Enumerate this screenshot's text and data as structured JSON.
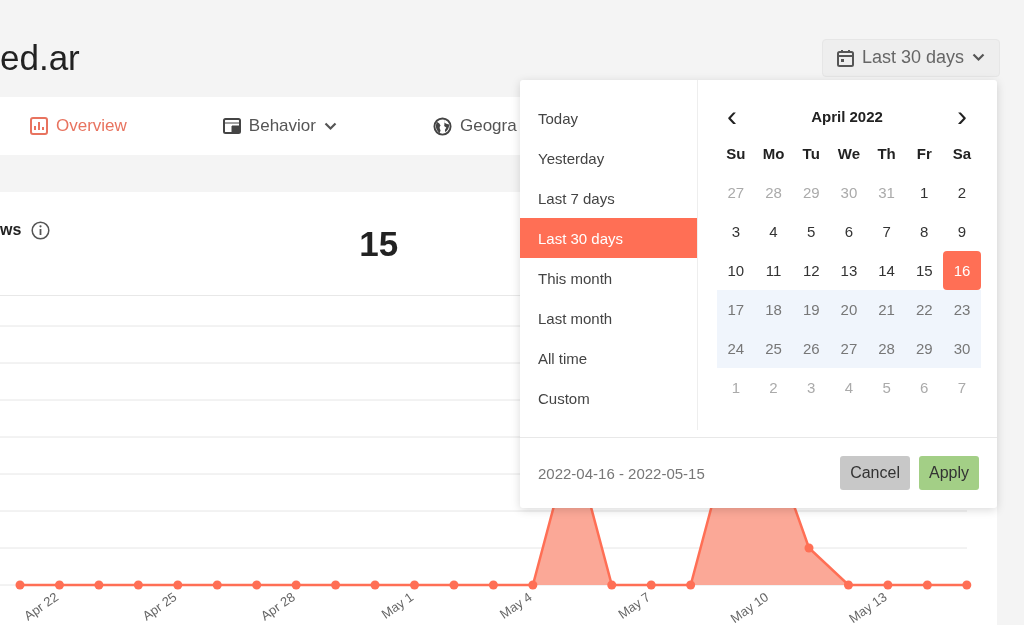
{
  "header": {
    "title": "ed.ar",
    "date_button": {
      "label": "Last 30 days"
    }
  },
  "nav": {
    "tabs": [
      {
        "label": "Overview",
        "kind": "chart",
        "dropdown": false,
        "selected": true
      },
      {
        "label": "Behavior",
        "kind": "layout",
        "dropdown": true,
        "selected": false
      },
      {
        "label": "Geogra",
        "kind": "globe",
        "dropdown": false,
        "selected": false
      }
    ]
  },
  "card": {
    "metric_label": "ws",
    "metric_value": "15",
    "chart": {
      "x_labels": [
        "Apr 22",
        "Apr 25",
        "Apr 28",
        "May 1",
        "May 4",
        "May 7",
        "May 10",
        "May 13"
      ]
    }
  },
  "date_picker": {
    "presets": [
      {
        "label": "Today",
        "selected": false
      },
      {
        "label": "Yesterday",
        "selected": false
      },
      {
        "label": "Last 7 days",
        "selected": false
      },
      {
        "label": "Last 30 days",
        "selected": true
      },
      {
        "label": "This month",
        "selected": false
      },
      {
        "label": "Last month",
        "selected": false
      },
      {
        "label": "All time",
        "selected": false
      },
      {
        "label": "Custom",
        "selected": false
      }
    ],
    "month": "April 2022",
    "prev": "‹",
    "next": "›",
    "weekdays": [
      "Su",
      "Mo",
      "Tu",
      "We",
      "Th",
      "Fr",
      "Sa"
    ],
    "weeks": [
      [
        {
          "day": "27",
          "outside": true,
          "selected": false,
          "in_range": false
        },
        {
          "day": "28",
          "outside": true,
          "selected": false,
          "in_range": false
        },
        {
          "day": "29",
          "outside": true,
          "selected": false,
          "in_range": false
        },
        {
          "day": "30",
          "outside": true,
          "selected": false,
          "in_range": false
        },
        {
          "day": "31",
          "outside": true,
          "selected": false,
          "in_range": false
        },
        {
          "day": "1",
          "outside": false,
          "selected": false,
          "in_range": false
        },
        {
          "day": "2",
          "outside": false,
          "selected": false,
          "in_range": false
        }
      ],
      [
        {
          "day": "3",
          "outside": false,
          "selected": false,
          "in_range": false
        },
        {
          "day": "4",
          "outside": false,
          "selected": false,
          "in_range": false
        },
        {
          "day": "5",
          "outside": false,
          "selected": false,
          "in_range": false
        },
        {
          "day": "6",
          "outside": false,
          "selected": false,
          "in_range": false
        },
        {
          "day": "7",
          "outside": false,
          "selected": false,
          "in_range": false
        },
        {
          "day": "8",
          "outside": false,
          "selected": false,
          "in_range": false
        },
        {
          "day": "9",
          "outside": false,
          "selected": false,
          "in_range": false
        }
      ],
      [
        {
          "day": "10",
          "outside": false,
          "selected": false,
          "in_range": false
        },
        {
          "day": "11",
          "outside": false,
          "selected": false,
          "in_range": false
        },
        {
          "day": "12",
          "outside": false,
          "selected": false,
          "in_range": false
        },
        {
          "day": "13",
          "outside": false,
          "selected": false,
          "in_range": false
        },
        {
          "day": "14",
          "outside": false,
          "selected": false,
          "in_range": false
        },
        {
          "day": "15",
          "outside": false,
          "selected": false,
          "in_range": false
        },
        {
          "day": "16",
          "outside": false,
          "selected": true,
          "in_range": false
        }
      ],
      [
        {
          "day": "17",
          "outside": false,
          "selected": false,
          "in_range": true
        },
        {
          "day": "18",
          "outside": false,
          "selected": false,
          "in_range": true
        },
        {
          "day": "19",
          "outside": false,
          "selected": false,
          "in_range": true
        },
        {
          "day": "20",
          "outside": false,
          "selected": false,
          "in_range": true
        },
        {
          "day": "21",
          "outside": false,
          "selected": false,
          "in_range": true
        },
        {
          "day": "22",
          "outside": false,
          "selected": false,
          "in_range": true
        },
        {
          "day": "23",
          "outside": false,
          "selected": false,
          "in_range": true
        }
      ],
      [
        {
          "day": "24",
          "outside": false,
          "selected": false,
          "in_range": true
        },
        {
          "day": "25",
          "outside": false,
          "selected": false,
          "in_range": true
        },
        {
          "day": "26",
          "outside": false,
          "selected": false,
          "in_range": true
        },
        {
          "day": "27",
          "outside": false,
          "selected": false,
          "in_range": true
        },
        {
          "day": "28",
          "outside": false,
          "selected": false,
          "in_range": true
        },
        {
          "day": "29",
          "outside": false,
          "selected": false,
          "in_range": true
        },
        {
          "day": "30",
          "outside": false,
          "selected": false,
          "in_range": true
        }
      ],
      [
        {
          "day": "1",
          "outside": true,
          "selected": false,
          "in_range": false
        },
        {
          "day": "2",
          "outside": true,
          "selected": false,
          "in_range": false
        },
        {
          "day": "3",
          "outside": true,
          "selected": false,
          "in_range": false
        },
        {
          "day": "4",
          "outside": true,
          "selected": false,
          "in_range": false
        },
        {
          "day": "5",
          "outside": true,
          "selected": false,
          "in_range": false
        },
        {
          "day": "6",
          "outside": true,
          "selected": false,
          "in_range": false
        },
        {
          "day": "7",
          "outside": true,
          "selected": false,
          "in_range": false
        }
      ]
    ],
    "range_text": "2022-04-16 - 2022-05-15",
    "buttons": [
      {
        "label": "Cancel",
        "kind": "cancel"
      },
      {
        "label": "Apply",
        "kind": "apply"
      }
    ]
  }
}
